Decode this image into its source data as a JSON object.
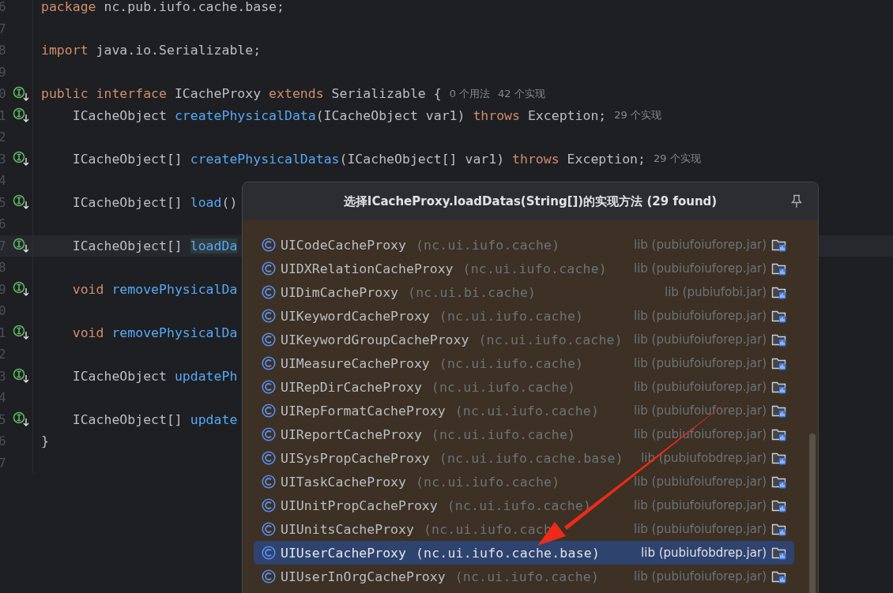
{
  "editor": {
    "lines": [
      {
        "number": "6",
        "marker": false,
        "current": false,
        "indent": false,
        "tokens": [
          {
            "t": "package",
            "kind": "kw"
          },
          {
            "t": " nc.pub.iufo.cache.base;",
            "kind": "tx"
          }
        ]
      },
      {
        "number": "7",
        "marker": false,
        "current": false
      },
      {
        "number": "8",
        "marker": false,
        "current": false,
        "indent": false,
        "tokens": [
          {
            "t": "import",
            "kind": "kw"
          },
          {
            "t": " java.io.Serializable;",
            "kind": "tx"
          }
        ]
      },
      {
        "number": "9",
        "marker": false,
        "current": false
      },
      {
        "number": "0",
        "marker": true,
        "current": false,
        "indent": false,
        "tokens": [
          {
            "t": "public interface",
            "kind": "kw"
          },
          {
            "t": " ICacheProxy ",
            "kind": "tx"
          },
          {
            "t": "extends",
            "kind": "kw"
          },
          {
            "t": " Serializable {",
            "kind": "tx"
          },
          {
            "t": "0 个用法",
            "kind": "hint"
          },
          {
            "t": "42 个实现",
            "kind": "hint"
          }
        ]
      },
      {
        "number": "1",
        "marker": true,
        "current": false,
        "indent": true,
        "tokens": [
          {
            "t": "ICacheObject ",
            "kind": "tx"
          },
          {
            "t": "createPhysicalData",
            "kind": "fn"
          },
          {
            "t": "(ICacheObject var1) ",
            "kind": "tx"
          },
          {
            "t": "throws",
            "kind": "kw"
          },
          {
            "t": " Exception;",
            "kind": "tx"
          },
          {
            "t": "29 个实现",
            "kind": "hint"
          }
        ]
      },
      {
        "number": "2",
        "marker": false,
        "current": false
      },
      {
        "number": "3",
        "marker": true,
        "current": false,
        "indent": true,
        "tokens": [
          {
            "t": "ICacheObject[] ",
            "kind": "tx"
          },
          {
            "t": "createPhysicalDatas",
            "kind": "fn"
          },
          {
            "t": "(ICacheObject[] var1) ",
            "kind": "tx"
          },
          {
            "t": "throws",
            "kind": "kw"
          },
          {
            "t": " Exception;",
            "kind": "tx"
          },
          {
            "t": "29 个实现",
            "kind": "hint"
          }
        ]
      },
      {
        "number": "4",
        "marker": false,
        "current": false
      },
      {
        "number": "5",
        "marker": true,
        "current": false,
        "indent": true,
        "tokens": [
          {
            "t": "ICacheObject[] ",
            "kind": "tx"
          },
          {
            "t": "load",
            "kind": "fn"
          },
          {
            "t": "()",
            "kind": "tx"
          }
        ]
      },
      {
        "number": "6",
        "marker": false,
        "current": false
      },
      {
        "number": "7",
        "marker": true,
        "current": true,
        "indent": true,
        "tokens": [
          {
            "t": "ICacheObject[] ",
            "kind": "tx"
          },
          {
            "t": "loadDa",
            "kind": "match"
          }
        ]
      },
      {
        "number": "8",
        "marker": false,
        "current": false
      },
      {
        "number": "9",
        "marker": true,
        "current": false,
        "indent": true,
        "tokens": [
          {
            "t": "void",
            "kind": "kw"
          },
          {
            "t": " removePhysicalDa",
            "kind": "fn"
          }
        ]
      },
      {
        "number": "0",
        "marker": false,
        "current": false
      },
      {
        "number": "1",
        "marker": true,
        "current": false,
        "indent": true,
        "tokens": [
          {
            "t": "void",
            "kind": "kw"
          },
          {
            "t": " removePhysicalDa",
            "kind": "fn"
          }
        ]
      },
      {
        "number": "2",
        "marker": false,
        "current": false
      },
      {
        "number": "3",
        "marker": true,
        "current": false,
        "indent": true,
        "tokens": [
          {
            "t": "ICacheObject ",
            "kind": "tx"
          },
          {
            "t": "updatePh",
            "kind": "fn"
          }
        ]
      },
      {
        "number": "4",
        "marker": false,
        "current": false
      },
      {
        "number": "5",
        "marker": true,
        "current": false,
        "indent": true,
        "tokens": [
          {
            "t": "ICacheObject[] ",
            "kind": "tx"
          },
          {
            "t": "update",
            "kind": "fn"
          }
        ]
      },
      {
        "number": "6",
        "marker": false,
        "current": false,
        "indent": false,
        "tokens": [
          {
            "t": "}",
            "kind": "tx"
          }
        ]
      },
      {
        "number": "7",
        "marker": false,
        "current": false
      }
    ]
  },
  "popup": {
    "title": "选择ICacheProxy.loadDatas(String[])的实现方法 (29 found)",
    "rows": [
      {
        "kind": "class",
        "name": "UICodeCacheProxy",
        "package": "(nc.ui.iufo.cache)",
        "location": "lib (pubiufoiuforep.jar)",
        "selected": false
      },
      {
        "kind": "class",
        "name": "UIDXRelationCacheProxy",
        "package": "(nc.ui.iufo.cache)",
        "location": "lib (pubiufoiuforep.jar)",
        "selected": false
      },
      {
        "kind": "class",
        "name": "UIDimCacheProxy",
        "package": "(nc.ui.bi.cache)",
        "location": "lib (pubiufobi.jar)",
        "selected": false
      },
      {
        "kind": "class",
        "name": "UIKeywordCacheProxy",
        "package": "(nc.ui.iufo.cache)",
        "location": "lib (pubiufoiuforep.jar)",
        "selected": false
      },
      {
        "kind": "class",
        "name": "UIKeywordGroupCacheProxy",
        "package": "(nc.ui.iufo.cache)",
        "location": "lib (pubiufoiuforep.jar)",
        "selected": false
      },
      {
        "kind": "class",
        "name": "UIMeasureCacheProxy",
        "package": "(nc.ui.iufo.cache)",
        "location": "lib (pubiufoiuforep.jar)",
        "selected": false
      },
      {
        "kind": "class",
        "name": "UIRepDirCacheProxy",
        "package": "(nc.ui.iufo.cache)",
        "location": "lib (pubiufoiuforep.jar)",
        "selected": false
      },
      {
        "kind": "class",
        "name": "UIRepFormatCacheProxy",
        "package": "(nc.ui.iufo.cache)",
        "location": "lib (pubiufoiuforep.jar)",
        "selected": false
      },
      {
        "kind": "class",
        "name": "UIReportCacheProxy",
        "package": "(nc.ui.iufo.cache)",
        "location": "lib (pubiufoiuforep.jar)",
        "selected": false
      },
      {
        "kind": "class",
        "name": "UISysPropCacheProxy",
        "package": "(nc.ui.iufo.cache.base)",
        "location": "lib (pubiufobdrep.jar)",
        "selected": false
      },
      {
        "kind": "class",
        "name": "UITaskCacheProxy",
        "package": "(nc.ui.iufo.cache)",
        "location": "lib (pubiufoiuforep.jar)",
        "selected": false
      },
      {
        "kind": "class",
        "name": "UIUnitPropCacheProxy",
        "package": "(nc.ui.iufo.cache)",
        "location": "lib (pubiufoiuforep.jar)",
        "selected": false
      },
      {
        "kind": "class",
        "name": "UIUnitsCacheProxy",
        "package": "(nc.ui.iufo.cach",
        "location": "lib (pubiufoiuforep.jar)",
        "selected": false
      },
      {
        "kind": "class",
        "name": "UIUserCacheProxy",
        "package": "(nc.ui.iufo.cache.base)",
        "location": "lib (pubiufobdrep.jar)",
        "selected": true
      },
      {
        "kind": "class",
        "name": "UIUserInOrgCacheProxy",
        "package": "(nc.ui.iufo.cache)",
        "location": "lib (pubiufoiuforep.jar)",
        "selected": false
      }
    ]
  }
}
